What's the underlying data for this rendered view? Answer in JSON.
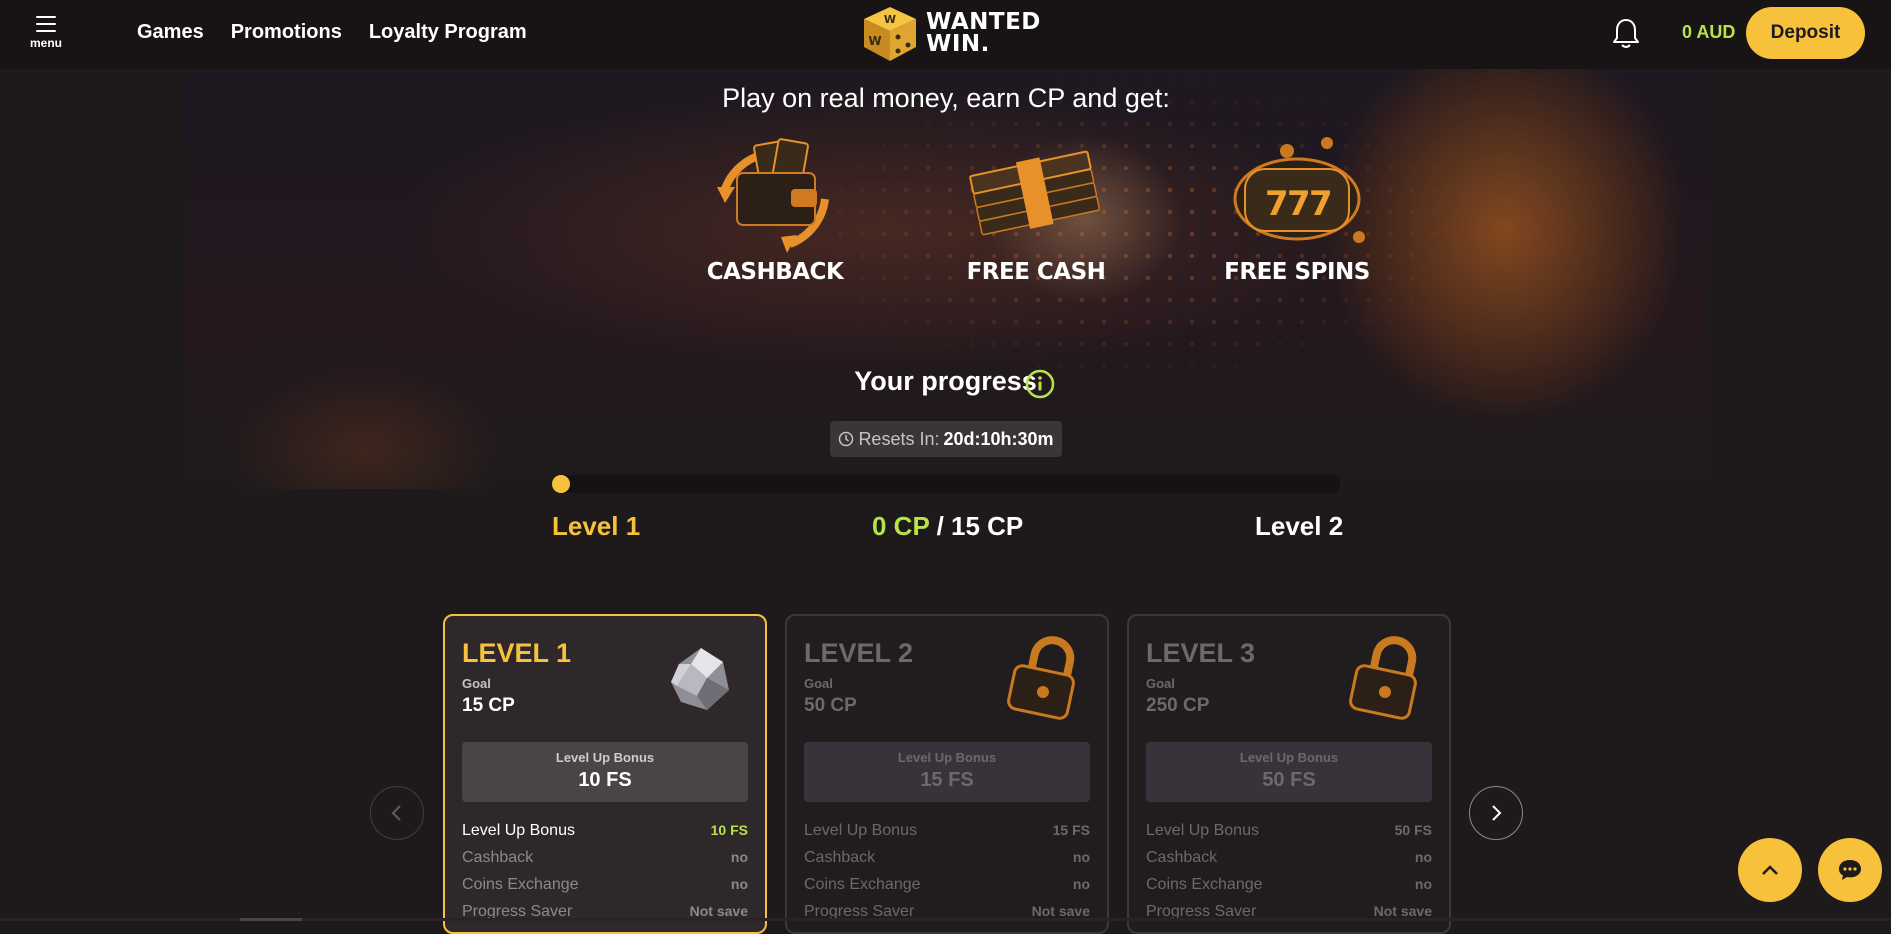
{
  "header": {
    "menu_label": "menu",
    "nav": [
      "Games",
      "Promotions",
      "Loyalty Program"
    ],
    "logo_line1": "WANTED",
    "logo_line2": "WIN.",
    "balance": "0 AUD",
    "deposit_label": "Deposit"
  },
  "hero": {
    "title": "Play on real money, earn CP and get:",
    "features": [
      {
        "label": "CASHBACK",
        "icon": "wallet-cards-icon"
      },
      {
        "label": "FREE CASH",
        "icon": "cash-stack-icon"
      },
      {
        "label": "FREE SPINS",
        "icon": "slot-777-icon"
      }
    ]
  },
  "progress": {
    "title": "Your progress",
    "resets_label": "Resets In:",
    "resets_value": "20d:10h:30m",
    "current_level": "Level 1",
    "cp_current": "0 CP",
    "cp_sep": " / ",
    "cp_goal": "15 CP",
    "next_level": "Level 2",
    "fill_fraction": 0
  },
  "levels": [
    {
      "title": "LEVEL 1",
      "goal_label": "Goal",
      "goal": "15 CP",
      "icon": "silver-ore-icon",
      "bonus_label": "Level Up Bonus",
      "bonus_value": "10 FS",
      "rows": [
        {
          "k": "Level Up Bonus",
          "v": "10 FS"
        },
        {
          "k": "Cashback",
          "v": "no"
        },
        {
          "k": "Coins Exchange",
          "v": "no"
        },
        {
          "k": "Progress Saver",
          "v": "Not save"
        }
      ]
    },
    {
      "title": "LEVEL 2",
      "goal_label": "Goal",
      "goal": "50 CP",
      "icon": "padlock-icon",
      "bonus_label": "Level Up Bonus",
      "bonus_value": "15 FS",
      "rows": [
        {
          "k": "Level Up Bonus",
          "v": "15 FS"
        },
        {
          "k": "Cashback",
          "v": "no"
        },
        {
          "k": "Coins Exchange",
          "v": "no"
        },
        {
          "k": "Progress Saver",
          "v": "Not save"
        }
      ]
    },
    {
      "title": "LEVEL 3",
      "goal_label": "Goal",
      "goal": "250 CP",
      "icon": "padlock-icon",
      "bonus_label": "Level Up Bonus",
      "bonus_value": "50 FS",
      "rows": [
        {
          "k": "Level Up Bonus",
          "v": "50 FS"
        },
        {
          "k": "Cashback",
          "v": "no"
        },
        {
          "k": "Coins Exchange",
          "v": "no"
        },
        {
          "k": "Progress Saver",
          "v": "Not save"
        }
      ]
    }
  ],
  "colors": {
    "accent": "#f7c13b",
    "green": "#b6e24a",
    "bg": "#1e1a1c"
  }
}
